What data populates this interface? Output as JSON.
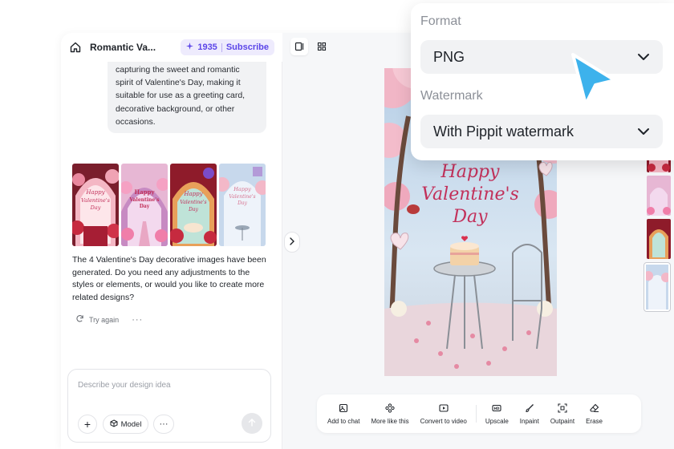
{
  "header": {
    "title": "Romantic Va...",
    "credits": "1935",
    "subscribe_label": "Subscribe"
  },
  "chat": {
    "prompt_text": "capturing the sweet and romantic spirit of Valentine's Day, making it suitable for use as a greeting card, decorative background, or other occasions.",
    "generated_thumb_text": [
      "Happy Valentine's Day",
      "Happy Valentine's Day",
      "Happy Valentine's Day",
      "Happy Valentine's Day"
    ],
    "reply_text": "The 4 Valentine's Day decorative images have been generated. Do you need any adjustments to the styles or elements, or would you like to create more related designs?",
    "try_again_label": "Try again",
    "more_label": "···"
  },
  "input": {
    "placeholder": "Describe your design idea",
    "add_label": "+",
    "model_label": "Model",
    "more_label": "···"
  },
  "canvas": {
    "image_text": "Happy Valentine's Day"
  },
  "toolbar": {
    "add_to_chat": "Add to chat",
    "more_like_this": "More like this",
    "convert_to_video": "Convert to video",
    "upscale": "Upscale",
    "inpaint": "Inpaint",
    "outpaint": "Outpaint",
    "erase": "Erase"
  },
  "popup": {
    "format_label": "Format",
    "format_value": "PNG",
    "watermark_label": "Watermark",
    "watermark_value": "With Pippit watermark"
  },
  "colors": {
    "accent": "#5b45e8",
    "accent_bg": "#eeebfd",
    "cursor": "#3db2ec",
    "rose": "#c2305a"
  }
}
